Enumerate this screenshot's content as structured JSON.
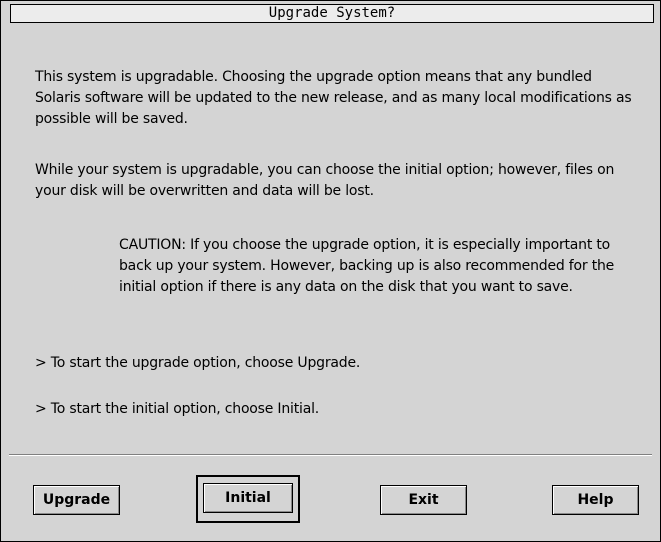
{
  "window": {
    "title": "Upgrade System?"
  },
  "content": {
    "paragraph1": "This system is upgradable. Choosing the upgrade option means that any bundled Solaris software will be updated to the new release, and as many local modifications as possible will be saved.",
    "paragraph2": "While your system is upgradable, you can choose the initial option; however, files on your disk will be overwritten and data will be lost.",
    "caution": "CAUTION: If you choose the upgrade option, it is especially important to back up your system. However, backing up is also recommended for the initial option if there is any data on the disk that you want to save.",
    "instruction_upgrade": "> To start the upgrade option, choose Upgrade.",
    "instruction_initial": "> To start the initial option, choose Initial."
  },
  "buttons": {
    "upgrade": "Upgrade",
    "initial": "Initial",
    "exit": "Exit",
    "help": "Help",
    "default": "Initial"
  }
}
